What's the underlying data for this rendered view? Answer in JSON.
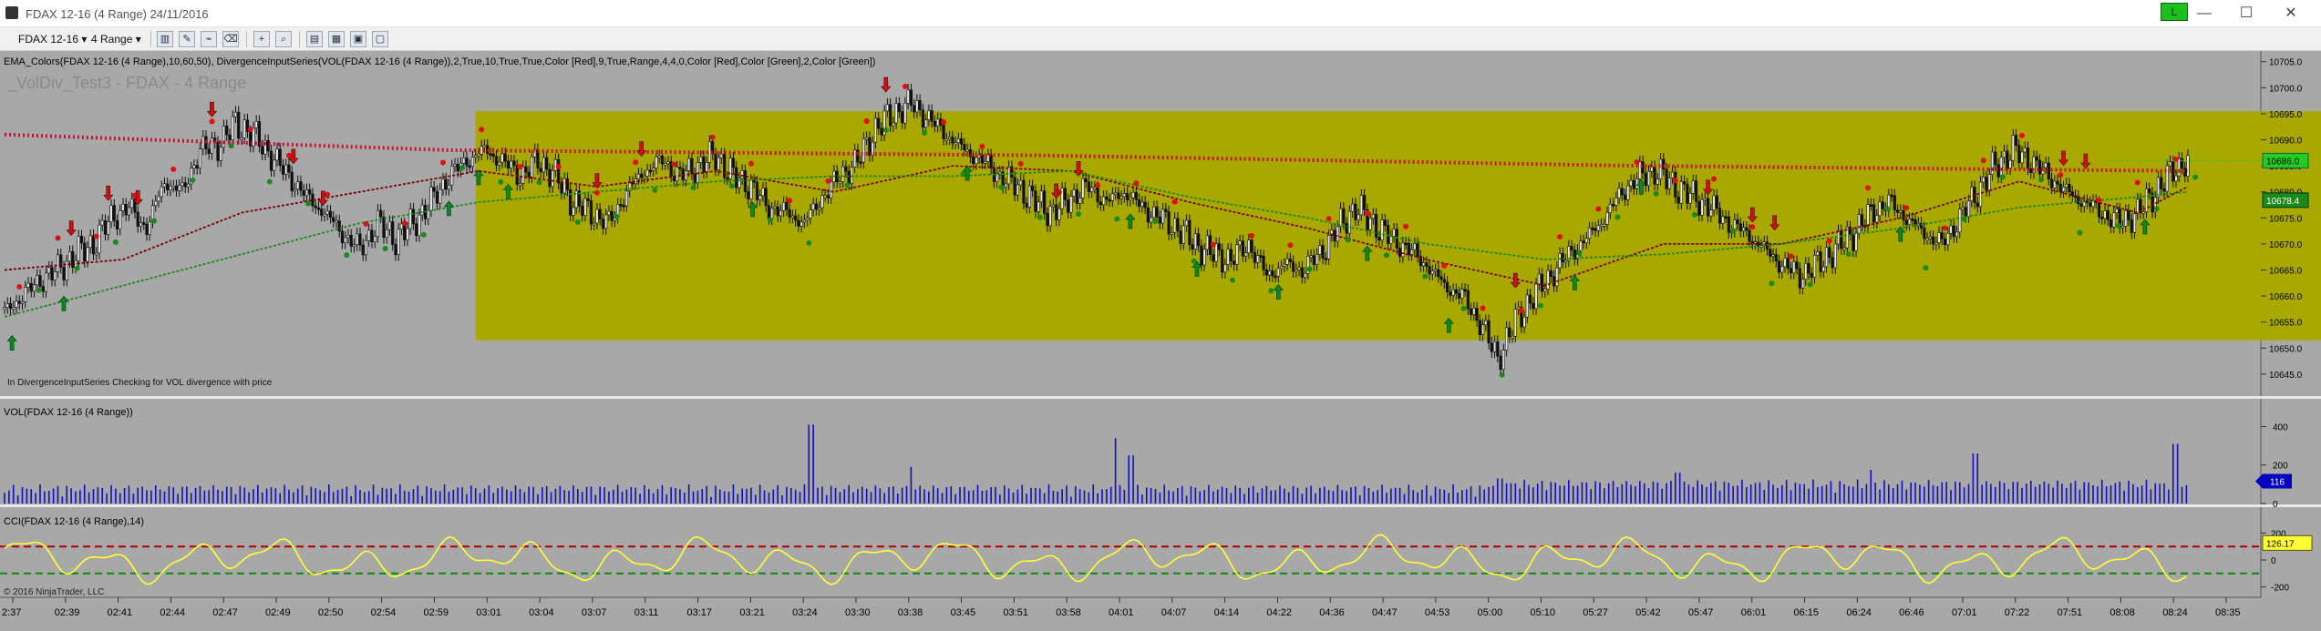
{
  "window": {
    "title": "FDAX 12-16 (4 Range)  24/11/2016",
    "connection_badge": "L",
    "minimize": "—",
    "maximize": "☐",
    "close": "✕"
  },
  "toolbar": {
    "instrument": "FDAX 12-16",
    "period": "4 Range",
    "dropdown_glyph": "▾",
    "icons": [
      "bar-style-icon",
      "pencil-draw-icon",
      "marker-icon",
      "crosshair-icon",
      "zoom-icon",
      "properties-icon",
      "indicators-icon",
      "strategies-icon",
      "data-box-icon"
    ]
  },
  "colors": {
    "background": "#a8a8a8",
    "highlight_box": "#a8a800",
    "ema_fast": "#7a0000",
    "ema_slow": "#1a8a1a",
    "ema_dotted": "#c8102e",
    "divergence_dotted": "#22cc22",
    "volume": "#1010c0",
    "cci": "#ffff33",
    "cci_upper": "#b00000",
    "cci_lower": "#0a8a0a",
    "price_marker": "#22cc22",
    "volume_marker": "#0000c0",
    "cci_marker": "#ffff33"
  },
  "chart_data": [
    {
      "type": "candlestick",
      "indicator_label": "EMA_Colors(FDAX 12-16 (4 Range),10,60,50), DivergenceInputSeries(VOL(FDAX 12-16 (4 Range)),2,True,10,True,True,Color [Red],9,True,Range,4,4,0,Color [Red],Color [Green],2,Color [Green])",
      "watermark": "_VolDiv_Test3 - FDAX - 4 Range",
      "note": "In DivergenceInputSeries Checking for VOL divergence with price",
      "y_ticks": [
        10705,
        10700,
        10695,
        10690,
        10685,
        10680,
        10675,
        10670,
        10665,
        10660,
        10655,
        10650,
        10645
      ],
      "y_tick_labels": [
        "10705.0",
        "10700.0",
        "10695.0",
        "10690.0",
        "10685.0",
        "10680.0",
        "10675.0",
        "10670.0",
        "10665.0",
        "10660.0",
        "10655.0",
        "10650.0",
        "10645.0"
      ],
      "ylim": [
        10642,
        10706
      ],
      "last_price": "10686.0",
      "ema_value": "10678.4",
      "ema_dotted_level": 10686.0,
      "highlight_range": [
        10651.5,
        10695.5
      ],
      "close_path": [
        [
          0,
          10657
        ],
        [
          12,
          10660
        ],
        [
          24,
          10663
        ],
        [
          36,
          10665
        ],
        [
          48,
          10668
        ],
        [
          60,
          10670
        ],
        [
          72,
          10675
        ],
        [
          84,
          10677
        ],
        [
          96,
          10673
        ],
        [
          108,
          10682
        ],
        [
          120,
          10680
        ],
        [
          132,
          10688
        ],
        [
          144,
          10689
        ],
        [
          156,
          10693
        ],
        [
          168,
          10691
        ],
        [
          180,
          10687
        ],
        [
          192,
          10683
        ],
        [
          204,
          10679
        ],
        [
          216,
          10676
        ],
        [
          228,
          10672
        ],
        [
          240,
          10669
        ],
        [
          252,
          10674
        ],
        [
          264,
          10671
        ],
        [
          276,
          10674
        ],
        [
          288,
          10678
        ],
        [
          300,
          10683
        ],
        [
          312,
          10686
        ],
        [
          324,
          10688
        ],
        [
          336,
          10686
        ],
        [
          348,
          10683
        ],
        [
          360,
          10686
        ],
        [
          372,
          10683
        ],
        [
          384,
          10678
        ],
        [
          396,
          10676
        ],
        [
          408,
          10674
        ],
        [
          420,
          10680
        ],
        [
          432,
          10684
        ],
        [
          444,
          10686
        ],
        [
          456,
          10683
        ],
        [
          468,
          10685
        ],
        [
          480,
          10687
        ],
        [
          492,
          10683
        ],
        [
          504,
          10681
        ],
        [
          516,
          10677
        ],
        [
          528,
          10676
        ],
        [
          540,
          10674
        ],
        [
          552,
          10679
        ],
        [
          564,
          10683
        ],
        [
          576,
          10686
        ],
        [
          588,
          10692
        ],
        [
          600,
          10695
        ],
        [
          612,
          10697
        ],
        [
          624,
          10694
        ],
        [
          636,
          10691
        ],
        [
          648,
          10688
        ],
        [
          660,
          10686
        ],
        [
          672,
          10683
        ],
        [
          684,
          10681
        ],
        [
          696,
          10678
        ],
        [
          708,
          10676
        ],
        [
          720,
          10679
        ],
        [
          732,
          10681
        ],
        [
          744,
          10678
        ],
        [
          756,
          10680
        ],
        [
          768,
          10677
        ],
        [
          780,
          10675
        ],
        [
          792,
          10673
        ],
        [
          804,
          10670
        ],
        [
          816,
          10668
        ],
        [
          828,
          10667
        ],
        [
          840,
          10670
        ],
        [
          852,
          10664
        ],
        [
          864,
          10666
        ],
        [
          876,
          10665
        ],
        [
          888,
          10668
        ],
        [
          900,
          10673
        ],
        [
          912,
          10677
        ],
        [
          924,
          10674
        ],
        [
          936,
          10671
        ],
        [
          948,
          10669
        ],
        [
          960,
          10666
        ],
        [
          972,
          10662
        ],
        [
          984,
          10660
        ],
        [
          996,
          10655
        ],
        [
          1008,
          10648
        ],
        [
          1020,
          10655
        ],
        [
          1032,
          10660
        ],
        [
          1044,
          10664
        ],
        [
          1056,
          10668
        ],
        [
          1068,
          10671
        ],
        [
          1080,
          10675
        ],
        [
          1092,
          10680
        ],
        [
          1104,
          10683
        ],
        [
          1116,
          10684
        ],
        [
          1128,
          10681
        ],
        [
          1140,
          10679
        ],
        [
          1152,
          10677
        ],
        [
          1164,
          10674
        ],
        [
          1176,
          10672
        ],
        [
          1188,
          10669
        ],
        [
          1200,
          10666
        ],
        [
          1212,
          10664
        ],
        [
          1224,
          10666
        ],
        [
          1236,
          10669
        ],
        [
          1248,
          10672
        ],
        [
          1260,
          10676
        ],
        [
          1272,
          10678
        ],
        [
          1284,
          10675
        ],
        [
          1296,
          10672
        ],
        [
          1308,
          10670
        ],
        [
          1320,
          10675
        ],
        [
          1332,
          10680
        ],
        [
          1344,
          10685
        ],
        [
          1356,
          10688
        ],
        [
          1368,
          10686
        ],
        [
          1380,
          10683
        ],
        [
          1392,
          10680
        ],
        [
          1404,
          10678
        ],
        [
          1416,
          10676
        ],
        [
          1428,
          10674
        ],
        [
          1440,
          10676
        ],
        [
          1452,
          10680
        ],
        [
          1464,
          10684
        ],
        [
          1474,
          10686
        ]
      ],
      "ema_fast": [
        [
          0,
          10665
        ],
        [
          80,
          10667
        ],
        [
          160,
          10676
        ],
        [
          240,
          10680
        ],
        [
          320,
          10684
        ],
        [
          400,
          10681
        ],
        [
          480,
          10684
        ],
        [
          560,
          10680
        ],
        [
          640,
          10685
        ],
        [
          720,
          10684
        ],
        [
          800,
          10678
        ],
        [
          880,
          10673
        ],
        [
          960,
          10667
        ],
        [
          1040,
          10662
        ],
        [
          1120,
          10670
        ],
        [
          1200,
          10670
        ],
        [
          1280,
          10675
        ],
        [
          1360,
          10682
        ],
        [
          1440,
          10676
        ],
        [
          1474,
          10681
        ]
      ],
      "ema_slow": [
        [
          0,
          10656
        ],
        [
          80,
          10662
        ],
        [
          160,
          10668
        ],
        [
          240,
          10674
        ],
        [
          320,
          10678
        ],
        [
          400,
          10680
        ],
        [
          480,
          10682
        ],
        [
          560,
          10683
        ],
        [
          640,
          10683
        ],
        [
          720,
          10684
        ],
        [
          800,
          10679
        ],
        [
          880,
          10675
        ],
        [
          960,
          10670
        ],
        [
          1040,
          10667
        ],
        [
          1120,
          10668
        ],
        [
          1200,
          10670
        ],
        [
          1280,
          10673
        ],
        [
          1360,
          10677
        ],
        [
          1440,
          10679
        ],
        [
          1474,
          10680
        ]
      ],
      "ema_dotted": [
        [
          0,
          10691
        ],
        [
          300,
          10688
        ],
        [
          700,
          10687
        ],
        [
          1100,
          10685
        ],
        [
          1474,
          10684
        ]
      ],
      "up_arrows": [
        5,
        40,
        300,
        320,
        340,
        505,
        650,
        760,
        805,
        860,
        920,
        975,
        1060,
        1105,
        1280,
        1445
      ],
      "down_arrows": [
        45,
        70,
        90,
        140,
        195,
        215,
        400,
        430,
        595,
        710,
        725,
        1020,
        1150,
        1180,
        1195,
        1390,
        1405
      ],
      "x_ticks": [
        "2:37",
        "02:39",
        "02:41",
        "02:44",
        "02:47",
        "02:49",
        "02:50",
        "02:54",
        "02:59",
        "03:01",
        "03:04",
        "03:07",
        "03:11",
        "03:17",
        "03:21",
        "03:24",
        "03:30",
        "03:38",
        "03:45",
        "03:51",
        "03:58",
        "04:01",
        "04:07",
        "04:14",
        "04:22",
        "04:36",
        "04:47",
        "04:53",
        "05:00",
        "05:10",
        "05:27",
        "05:42",
        "05:47",
        "06:01",
        "06:15",
        "06:24",
        "06:46",
        "07:01",
        "07:22",
        "07:51",
        "08:08",
        "08:24",
        "08:35"
      ]
    },
    {
      "type": "bar",
      "indicator_label": "VOL(FDAX 12-16 (4 Range))",
      "y_tick_labels": [
        "400",
        "200",
        "0"
      ],
      "ylim": [
        0,
        440
      ],
      "last_value": "116",
      "spikes": [
        [
          545,
          410
        ],
        [
          750,
          340
        ],
        [
          760,
          250
        ],
        [
          1130,
          160
        ],
        [
          1330,
          260
        ],
        [
          1465,
          310
        ],
        [
          612,
          190
        ],
        [
          1010,
          130
        ],
        [
          1260,
          175
        ]
      ]
    },
    {
      "type": "line",
      "indicator_label": "CCI(FDAX 12-16 (4 Range),14)",
      "y_tick_labels": [
        "200",
        "0",
        "-200"
      ],
      "ylim": [
        -250,
        250
      ],
      "upper_level": 100,
      "lower_level": -100,
      "last_value": "126.17"
    }
  ],
  "footer": {
    "copyright": "© 2016 NinjaTrader, LLC"
  }
}
